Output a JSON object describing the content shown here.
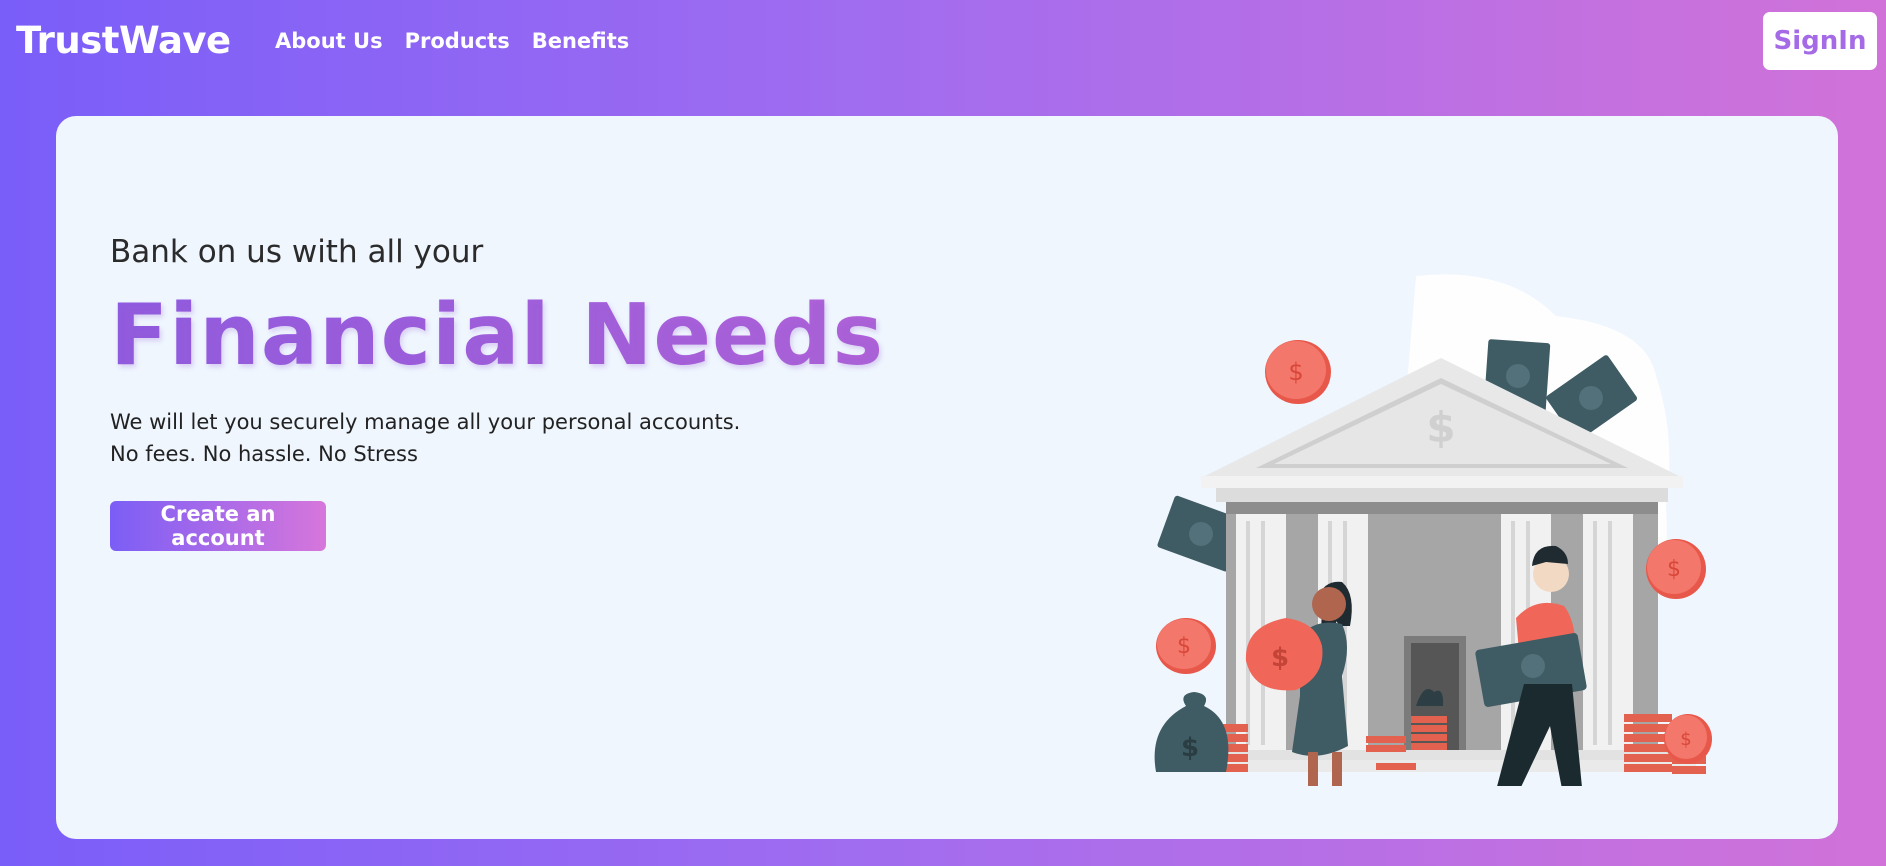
{
  "brand": {
    "name": "TrustWave"
  },
  "nav": {
    "links": [
      "About Us",
      "Products",
      "Benefits"
    ],
    "signin_label": "SignIn"
  },
  "hero": {
    "subtitle": "Bank on us with all your",
    "title": "Financial Needs",
    "description_line1": "We will let you securely manage all your personal accounts.",
    "description_line2": "No fees. No hassle. No Stress",
    "cta_label": "Create an account"
  },
  "colors": {
    "bg_gradient_start": "#7a5ef9",
    "bg_gradient_end": "#d172d9",
    "card_bg": "#eff6fe",
    "accent_purple": "#9a5fdc",
    "coin_red": "#f36b5e",
    "money_green": "#3f5b63"
  },
  "icons": {
    "illustration": "bank-building-with-people-illustration",
    "coin": "dollar-coin-icon",
    "banknote": "banknote-icon",
    "moneybag": "money-bag-icon"
  }
}
